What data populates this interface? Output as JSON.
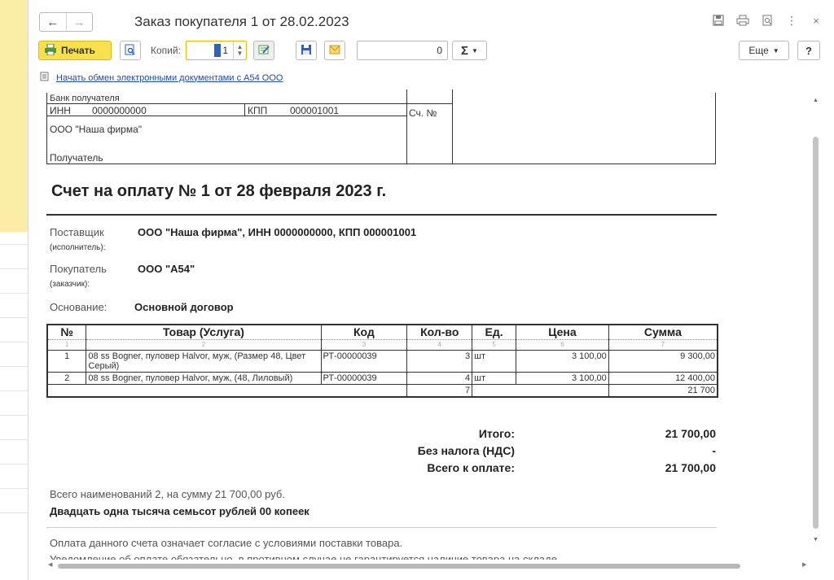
{
  "window": {
    "title": "Заказ покупателя 1 от 28.02.2023"
  },
  "nav": {
    "back_icon": "arrow-left-icon",
    "forward_icon": "arrow-right-icon"
  },
  "toolbar": {
    "print_label": "Печать",
    "copies_label": "Копий:",
    "copies_value": "1",
    "number_value": "0",
    "sum_label": "Σ",
    "more_label": "Еще",
    "help_label": "?"
  },
  "edo": {
    "link_text": "Начать обмен электронными документами с А54 ООО"
  },
  "invoice": {
    "bank_label": "Банк получателя",
    "inn_label": "ИНН",
    "inn_value": "0000000000",
    "kpp_label": "КПП",
    "kpp_value": "000001001",
    "account_label": "Сч. №",
    "org_name": "ООО \"Наша фирма\"",
    "recipient_label": "Получатель",
    "title": "Счет на оплату № 1 от 28 февраля 2023 г.",
    "supplier_label": "Поставщик",
    "supplier_sub": "(исполнитель):",
    "supplier_value": "ООО \"Наша фирма\",  ИНН 0000000000,  КПП 000001001",
    "buyer_label": "Покупатель",
    "buyer_sub": "(заказчик):",
    "buyer_value": "ООО \"А54\"",
    "basis_label": "Основание:",
    "basis_value": "Основной договор",
    "table": {
      "headers": [
        "№",
        "Товар (Услуга)",
        "Код",
        "Кол-во",
        "Ед.",
        "Цена",
        "Сумма"
      ],
      "col_numbers": [
        "1",
        "2",
        "3",
        "4",
        "5",
        "6",
        "7"
      ],
      "rows": [
        {
          "n": "1",
          "name": "08 ss Bogner, пуловер Halvor, муж, (Размер 48, Цвет Серый)",
          "code": "РТ-00000039",
          "qty": "3",
          "unit": "шт",
          "price": "3 100,00",
          "sum": "9 300,00"
        },
        {
          "n": "2",
          "name": "08 ss Bogner, пуловер Halvor, муж, (48, Лиловый)",
          "code": "РТ-00000039",
          "qty": "4",
          "unit": "шт",
          "price": "3 100,00",
          "sum": "12 400,00"
        }
      ],
      "total_qty": "7",
      "total_sum": "21 700"
    },
    "totals": {
      "itogo_label": "Итого:",
      "itogo_value": "21 700,00",
      "vat_label": "Без налога (НДС)",
      "vat_value": "-",
      "total_label": "Всего к оплате:",
      "total_value": "21 700,00"
    },
    "summary_line": "Всего наименований 2, на сумму 21 700,00 руб.",
    "amount_words": "Двадцать одна тысяча семьсот рублей 00 копеек",
    "note1": "Оплата данного счета означает согласие с условиями поставки товара.",
    "note2": "Уведомление об оплате обязательно, в противном случае не гарантируется наличие товара на складе."
  }
}
